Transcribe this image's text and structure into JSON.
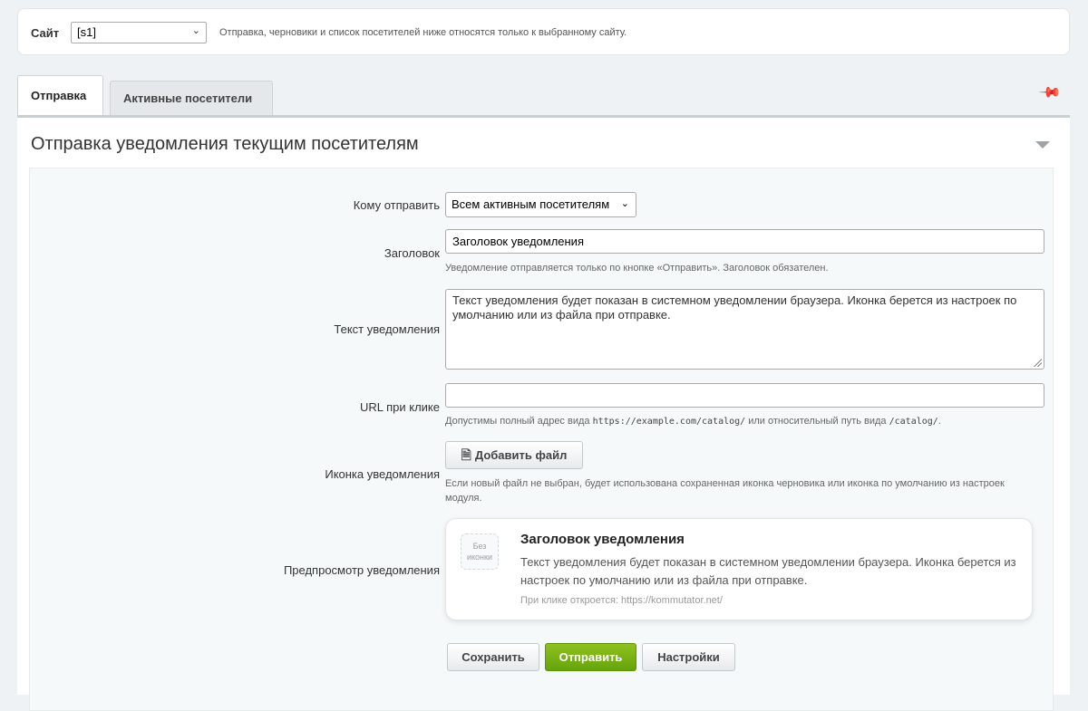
{
  "site_bar": {
    "label": "Сайт",
    "select_value": "[s1]",
    "hint": "Отправка, черновики и список посетителей ниже относятся только к выбранному сайту."
  },
  "tabs": [
    {
      "label": "Отправка",
      "active": true
    },
    {
      "label": "Активные посетители",
      "active": false
    }
  ],
  "panel": {
    "title": "Отправка уведомления текущим посетителям"
  },
  "form": {
    "audience_label": "Кому отправить",
    "audience_value": "Всем активным посетителям",
    "title_label": "Заголовок",
    "title_value": "Заголовок уведомления",
    "title_hint": "Уведомление отправляется только по кнопке «Отправить». Заголовок обязателен.",
    "text_label": "Текст уведомления",
    "text_value": "Текст уведомления будет показан в системном уведомлении браузера. Иконка берется из настроек по умолчанию или из файла при отправке.",
    "url_label": "URL при клике",
    "url_value": "",
    "url_hint_prefix": "Допустимы полный адрес вида",
    "url_hint_code1": "https://example.com/catalog/",
    "url_hint_middle": "или относительный путь вида",
    "url_hint_code2": "/catalog/",
    "url_hint_suffix": ".",
    "icon_label": "Иконка уведомления",
    "add_file_label": "Добавить файл",
    "icon_hint": "Если новый файл не выбран, будет использована сохраненная иконка черновика или иконка по умолчанию из настроек модуля.",
    "preview_label": "Предпросмотр уведомления"
  },
  "preview": {
    "no_icon_line1": "Без",
    "no_icon_line2": "иконки",
    "title": "Заголовок уведомления",
    "body": "Текст уведомления будет показан в системном уведомлении браузера. Иконка берется из настроек по умолчанию или из файла при отправке.",
    "url_text": "При клике откроется: https://kommutator.net/"
  },
  "buttons": {
    "save": "Сохранить",
    "send": "Отправить",
    "settings": "Настройки"
  },
  "colors": {
    "accent_green": "#7ab317",
    "page_bg": "#eef2f4"
  }
}
